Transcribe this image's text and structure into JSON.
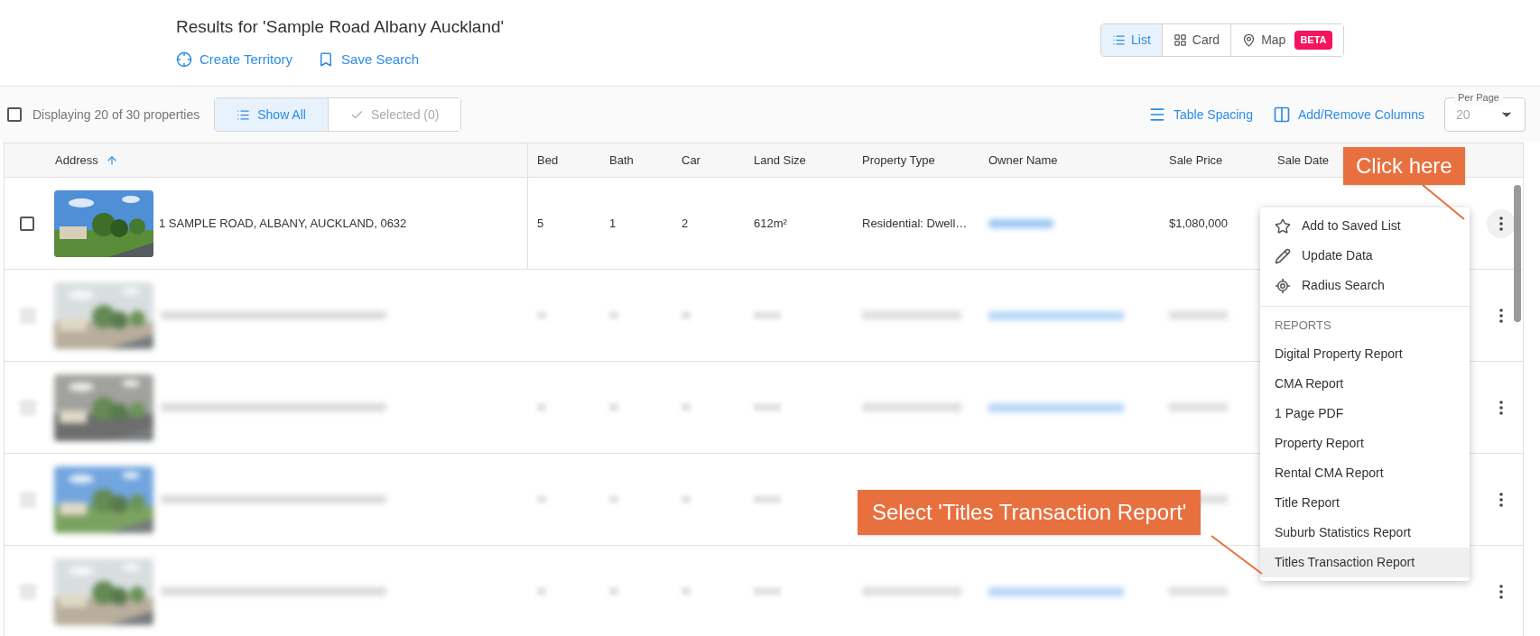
{
  "header": {
    "title": "Results for 'Sample Road Albany Auckland'",
    "actions": [
      {
        "label": "Create Territory"
      },
      {
        "label": "Save Search"
      }
    ]
  },
  "view_toggle": [
    {
      "label": "List",
      "selected": true
    },
    {
      "label": "Card",
      "selected": false
    },
    {
      "label": "Map",
      "selected": false,
      "badge": "BETA"
    }
  ],
  "toolbar": {
    "display_text": "Displaying 20 of 30 properties",
    "select_all_checked": false,
    "filters": [
      {
        "label": "Show All",
        "selected": true
      },
      {
        "label": "Selected (0)",
        "selected": false
      }
    ],
    "actions": [
      {
        "label": "Table Spacing"
      },
      {
        "label": "Add/Remove Columns"
      }
    ],
    "per_page": {
      "label": "Per Page",
      "value": "20"
    }
  },
  "table": {
    "columns": [
      "Address",
      "Bed",
      "Bath",
      "Car",
      "Land Size",
      "Property Type",
      "Owner Name",
      "Sale Price",
      "Sale Date"
    ],
    "rows": [
      {
        "kind": "full",
        "checked": false,
        "address": "1 SAMPLE ROAD, ALBANY, AUCKLAND, 0632",
        "bed": "5",
        "bath": "1",
        "car": "2",
        "land_size": "612m²",
        "property_type": "Residential: Dwell…",
        "sale_price": "$1,080,000"
      },
      {
        "kind": "blurred",
        "checked": false
      },
      {
        "kind": "blurred",
        "checked": false
      },
      {
        "kind": "blurred",
        "checked": false
      },
      {
        "kind": "blurred",
        "checked": false
      }
    ]
  },
  "menu": {
    "items": [
      {
        "label": "Add to Saved List",
        "selected": false
      },
      {
        "label": "Update Data",
        "selected": false
      },
      {
        "label": "Radius Search",
        "selected": false
      }
    ],
    "section": "REPORTS",
    "reports": [
      {
        "label": "Digital Property Report",
        "selected": false
      },
      {
        "label": "CMA Report",
        "selected": false
      },
      {
        "label": "1 Page PDF",
        "selected": false
      },
      {
        "label": "Property Report",
        "selected": false
      },
      {
        "label": "Rental CMA Report",
        "selected": false
      },
      {
        "label": "Title Report",
        "selected": false
      },
      {
        "label": "Suburb Statistics Report",
        "selected": false
      },
      {
        "label": "Titles Transaction Report",
        "selected": true
      }
    ]
  },
  "callouts": [
    "Click here",
    "Select 'Titles Transaction Report'"
  ]
}
